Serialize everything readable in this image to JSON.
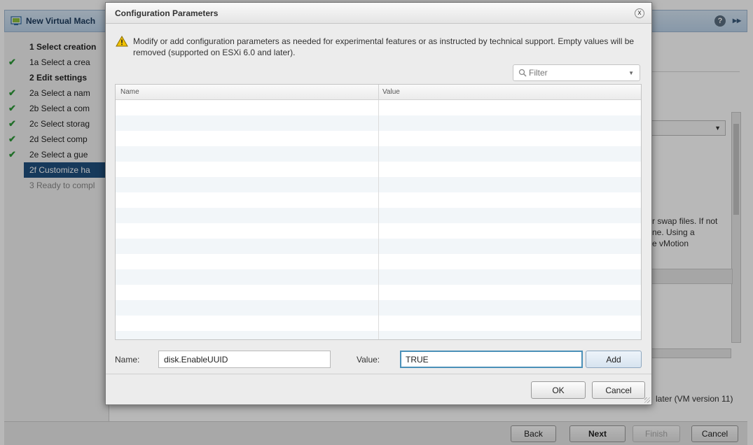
{
  "wizard": {
    "title": "New Virtual Mach",
    "help_icon": "?",
    "expand_icon": "▸▸",
    "steps": [
      {
        "label": "1  Select creation",
        "type": "head",
        "check": false
      },
      {
        "label": "1a  Select a crea",
        "type": "sub",
        "check": true
      },
      {
        "label": "2  Edit settings",
        "type": "head",
        "check": false
      },
      {
        "label": "2a  Select a nam",
        "type": "sub",
        "check": true
      },
      {
        "label": "2b  Select a com",
        "type": "sub",
        "check": true
      },
      {
        "label": "2c  Select storag",
        "type": "sub",
        "check": true
      },
      {
        "label": "2d  Select comp",
        "type": "sub",
        "check": true
      },
      {
        "label": "2e  Select a gue",
        "type": "sub",
        "check": true
      },
      {
        "label": "2f  Customize ha",
        "type": "active",
        "check": false
      },
      {
        "label": "3  Ready to compl",
        "type": "disabled",
        "check": false
      }
    ],
    "background_text": "r swap files. If not ne. Using a e vMotion",
    "background_text_lines": [
      "r swap files. If not",
      "ne. Using a",
      "e vMotion"
    ],
    "compat_text": "later (VM version 11)",
    "footer": {
      "back": "Back",
      "next": "Next",
      "finish": "Finish",
      "cancel": "Cancel"
    }
  },
  "dialog": {
    "title": "Configuration Parameters",
    "close_icon": "x",
    "warning": "Modify or add configuration parameters as needed for experimental features or as instructed by technical support. Empty values will be removed (supported on ESXi 6.0 and later).",
    "filter_placeholder": "Filter",
    "table": {
      "columns": [
        "Name",
        "Value"
      ],
      "rows": []
    },
    "name_label": "Name:",
    "name_value": "disk.EnableUUID",
    "value_label": "Value:",
    "value_value": "TRUE",
    "add_button": "Add",
    "ok_button": "OK",
    "cancel_button": "Cancel"
  },
  "colors": {
    "active_step": "#1f4f7f",
    "check": "#2e9a3a",
    "focus_border": "#4a90b8",
    "warning": "#f2c200"
  }
}
